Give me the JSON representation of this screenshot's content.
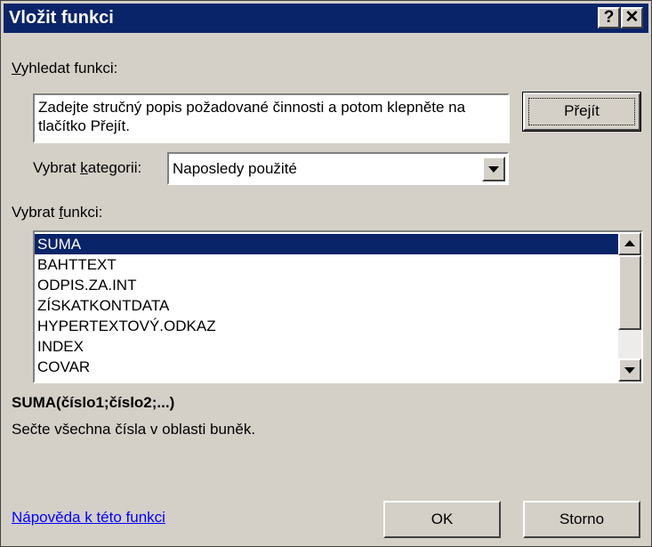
{
  "title": "Vložit funkci",
  "help_button": "?",
  "close_button": "✕",
  "search": {
    "label_prefix": "V",
    "label_rest": "yhledat funkci:",
    "value": "Zadejte stručný popis požadované činnosti a potom klepněte na tlačítko Přejít.",
    "go_button": "Přejít"
  },
  "category": {
    "label_prefix": "Vybrat ",
    "label_accel": "k",
    "label_rest": "ategorii:",
    "selected": "Naposledy použité"
  },
  "function_list": {
    "label_prefix": "Vybrat ",
    "label_accel": "f",
    "label_rest": "unkci:",
    "items": [
      "SUMA",
      "BAHTTEXT",
      "ODPIS.ZA.INT",
      "ZÍSKATKONTDATA",
      "HYPERTEXTOVÝ.ODKAZ",
      "INDEX",
      "COVAR"
    ]
  },
  "description": {
    "signature": "SUMA(číslo1;číslo2;...)",
    "text": "Sečte všechna čísla v oblasti buněk."
  },
  "footer": {
    "help_link": "Nápověda k této funkci",
    "ok": "OK",
    "cancel": "Storno"
  }
}
